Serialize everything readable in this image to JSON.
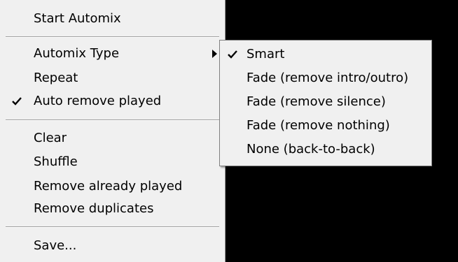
{
  "main_menu": {
    "start_automix": "Start Automix",
    "automix_type": "Automix Type",
    "repeat": "Repeat",
    "auto_remove_played": "Auto remove played",
    "clear": "Clear",
    "shuffle": "Shuffle",
    "remove_already_played": "Remove already played",
    "remove_duplicates": "Remove duplicates",
    "save": "Save..."
  },
  "automix_submenu": {
    "smart": "Smart",
    "fade_intro_outro": "Fade (remove intro/outro)",
    "fade_silence": "Fade (remove silence)",
    "fade_nothing": "Fade (remove nothing)",
    "none_back_to_back": "None (back-to-back)"
  },
  "state": {
    "auto_remove_played_checked": true,
    "automix_type_selected": "Smart"
  },
  "icons": {
    "check": "checkmark-icon",
    "submenu_arrow": "submenu-arrow-icon"
  },
  "colors": {
    "menu_background": "#f0f0f0",
    "separator": "#a0a0a0",
    "backdrop": "#000000",
    "text": "#000000"
  }
}
